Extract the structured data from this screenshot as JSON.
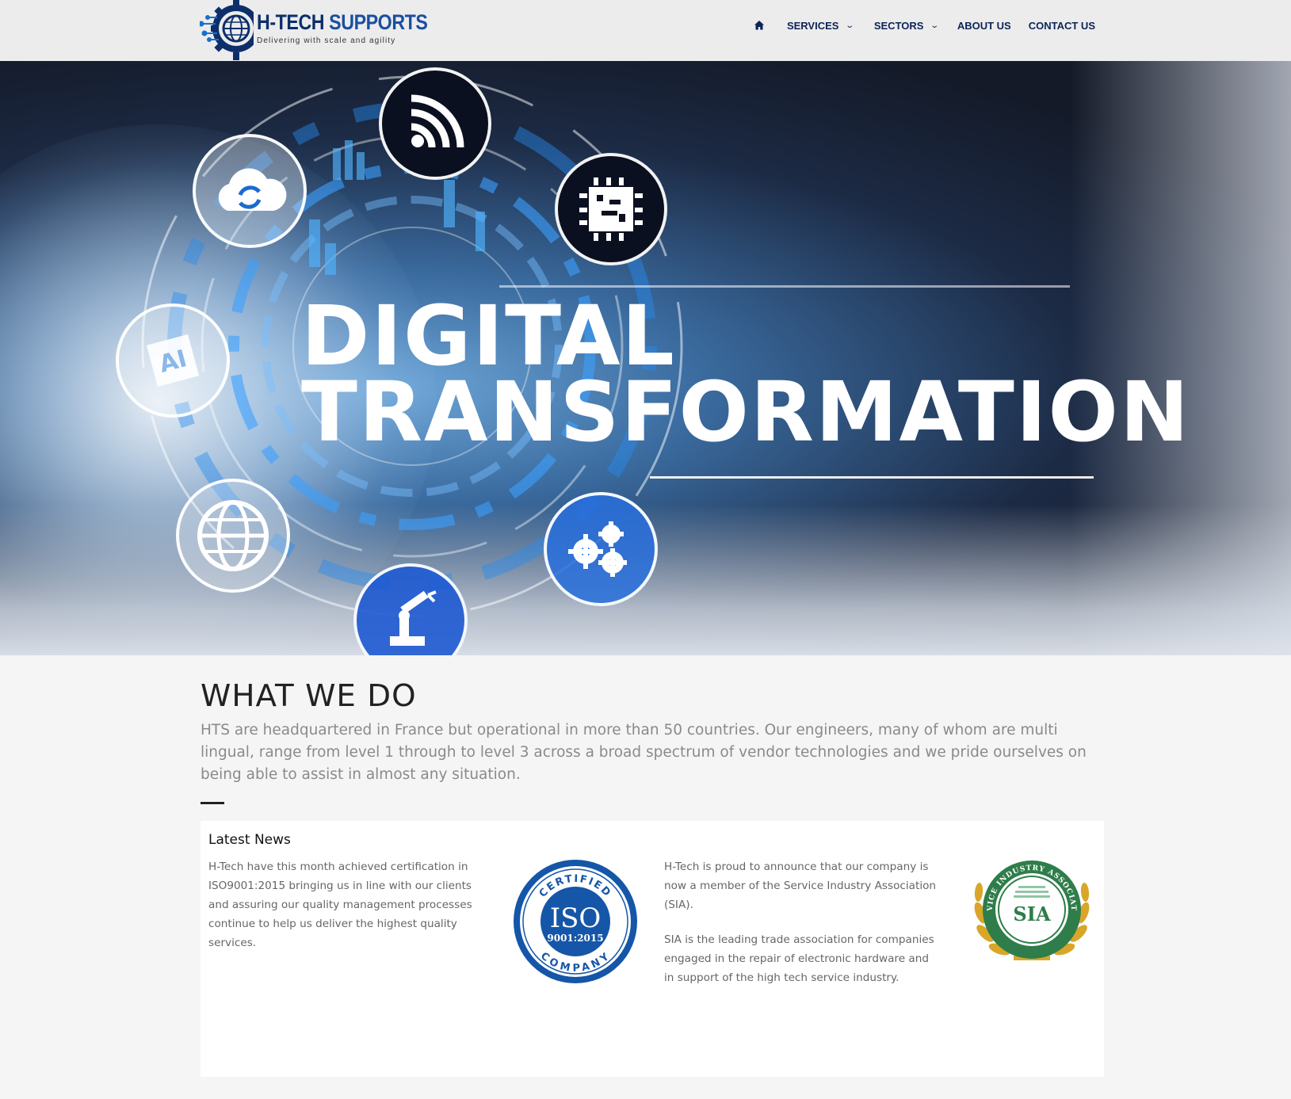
{
  "header": {
    "logo": {
      "name_first": "H-TECH",
      "name_second": "SUPPORTS",
      "tagline": "Delivering with scale and agility"
    },
    "nav": {
      "home_icon": "home-icon",
      "services": "SERVICES",
      "sectors": "SECTORS",
      "about": "ABOUT US",
      "contact": "CONTACT US",
      "chevron": "⌄"
    }
  },
  "hero": {
    "line1": "DIGITAL",
    "line2": "TRANSFORMATION",
    "icons": [
      "wifi-icon",
      "cloud-sync-icon",
      "chip-icon",
      "ai-chip-icon",
      "globe-icon",
      "gears-icon",
      "robot-arm-icon"
    ]
  },
  "what_we_do": {
    "title": "WHAT WE DO",
    "text": "HTS are headquartered in France but operational in more than 50 countries. Our engineers, many of whom are multi lingual, range from level 1 through to level 3 across a broad spectrum of vendor technologies and we pride ourselves on being able to assist in almost any situation."
  },
  "news": {
    "title": "Latest News",
    "item1": "H-Tech have this month achieved certification in ISO9001:2015 bringing us in line with our clients and assuring our quality management processes continue to help us deliver the highest quality services.",
    "item2_p1": "H-Tech is proud to announce that our company is now a member of the Service Industry Association (SIA).",
    "item2_p2": "SIA is the leading trade association for companies engaged in the repair of electronic hardware and in support of the high tech service industry.",
    "iso_badge": {
      "top": "CERTIFIED",
      "main": "ISO",
      "sub": "9001:2015",
      "bottom": "COMPANY"
    },
    "sia_badge": {
      "ring": "SERVICE INDUSTRY ASSOCIATION",
      "main": "SIA"
    }
  },
  "colors": {
    "nav": "#0c2456",
    "brand_dark": "#0c2f6b",
    "iso_blue": "#1556a8",
    "sia_green": "#2e7d4a",
    "sia_gold": "#d9a62a"
  }
}
